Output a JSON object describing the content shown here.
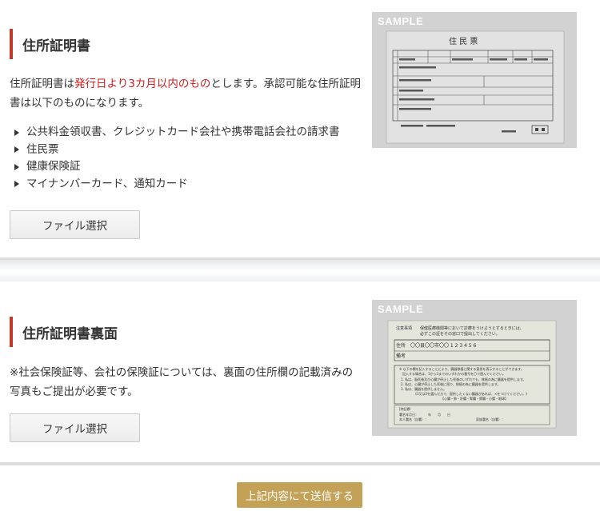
{
  "section1": {
    "heading": "住所証明書",
    "text_part1": "住所証明書は",
    "text_highlight": "発行日より3カ月以内のもの",
    "text_part2": "とします。承認可能な住所証明書は以下のものになります。",
    "list": [
      "公共料金領収書、クレジットカード会社や携帯電話会社の請求書",
      "住民票",
      "健康保険証",
      "マイナンバーカード、通知カード"
    ],
    "file_button_label": "ファイル選択",
    "sample_label": "SAMPLE",
    "sample_doc_title": "住 民 票"
  },
  "section2": {
    "heading": "住所証明書裏面",
    "text": "※社会保険証等、会社の保険証については、裏面の住所欄の記載済みの写真もご提出が必要です。",
    "file_button_label": "ファイル選択",
    "sample_label": "SAMPLE",
    "card_note_label": "注意事項",
    "card_note_line1": "保健医療機関等において診療をうけようとするときには、",
    "card_note_line2": "必ずこの証をその窓口で提出してください。",
    "card_address_label": "住所",
    "card_address_value": "〇〇县〇〇市〇〇 1 2 3 4 5 6",
    "card_remarks_label": "備考",
    "card_instructions": [
      "※ 以下の欄を記入することにより、臓器移植に関する意思を表示することができます。",
      "記入する場合は、1から3までのいずれかの番号を〇で囲んでください。",
      "1. 私は、脳死後及び心臓が停止した死後のいずれでも、移植の為に臓器を提供します。",
      "2. 私は、心臓が停止した死後に限り、移植の為に臓器を提供します。",
      "3. 私は、臓器を提供しません。",
      "《1又は2を選んだ方で、提供したくない臓器があれば、×をつけてください。》",
      "【心臓・肺・肝臓・腎臓・膵臓・小腸・眼球】"
    ],
    "card_special_label": "[特記欄：",
    "card_sign_date": "署名年月日：　　　年　　月　　日",
    "card_sign_self": "本人署名（自署）：",
    "card_sign_family": "家族署名（自署）："
  },
  "submit_label": "上記内容にて送信する",
  "colors": {
    "accent_bar": "#c0392b",
    "highlight_text": "#cc1f1f",
    "submit_bg": "#c3a257",
    "sample_bg": "#d2d2d2"
  }
}
